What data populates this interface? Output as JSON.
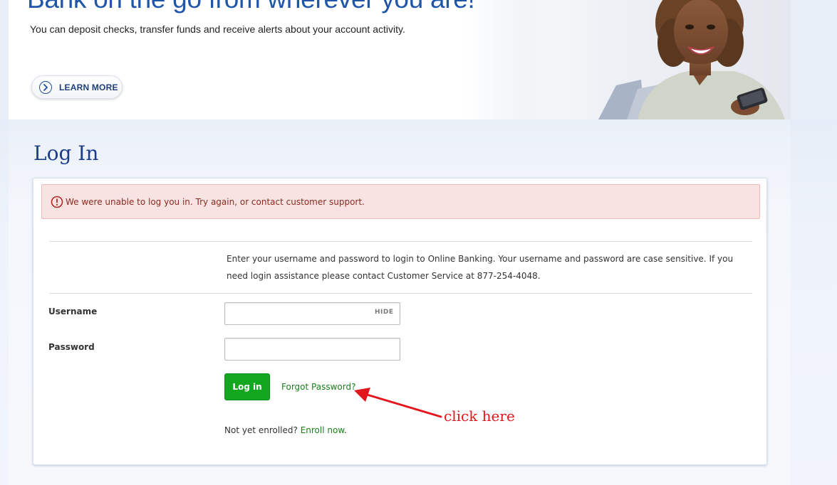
{
  "hero": {
    "title": "Bank on the go from wherever you are!",
    "subtitle": "You can deposit checks, transfer funds and receive alerts about your account activity.",
    "learn_more": "LEARN MORE"
  },
  "login": {
    "title": "Log In",
    "error_message": "We were unable to log you in. Try again, or contact customer support.",
    "instructions": "Enter your username and password to login to Online Banking.  Your username and password are case sensitive.  If you need login assistance please contact Customer Service at 877-254-4048.",
    "username_label": "Username",
    "username_value": "",
    "hide_label": "HIDE",
    "password_label": "Password",
    "password_value": "",
    "submit_label": "Log in",
    "forgot_password": "Forgot Password?",
    "enroll_prefix": "Not yet enrolled? ",
    "enroll_link": "Enroll now",
    "enroll_suffix": "."
  },
  "annotation": {
    "text": "click here",
    "color": "#e3161e"
  },
  "colors": {
    "brand_blue": "#1f56a8",
    "title_navy": "#1c3d8c",
    "success_green": "#13a61f",
    "link_green": "#1a7f1a",
    "error_bg": "#f8e3e3",
    "error_text": "#8a2a1f"
  }
}
